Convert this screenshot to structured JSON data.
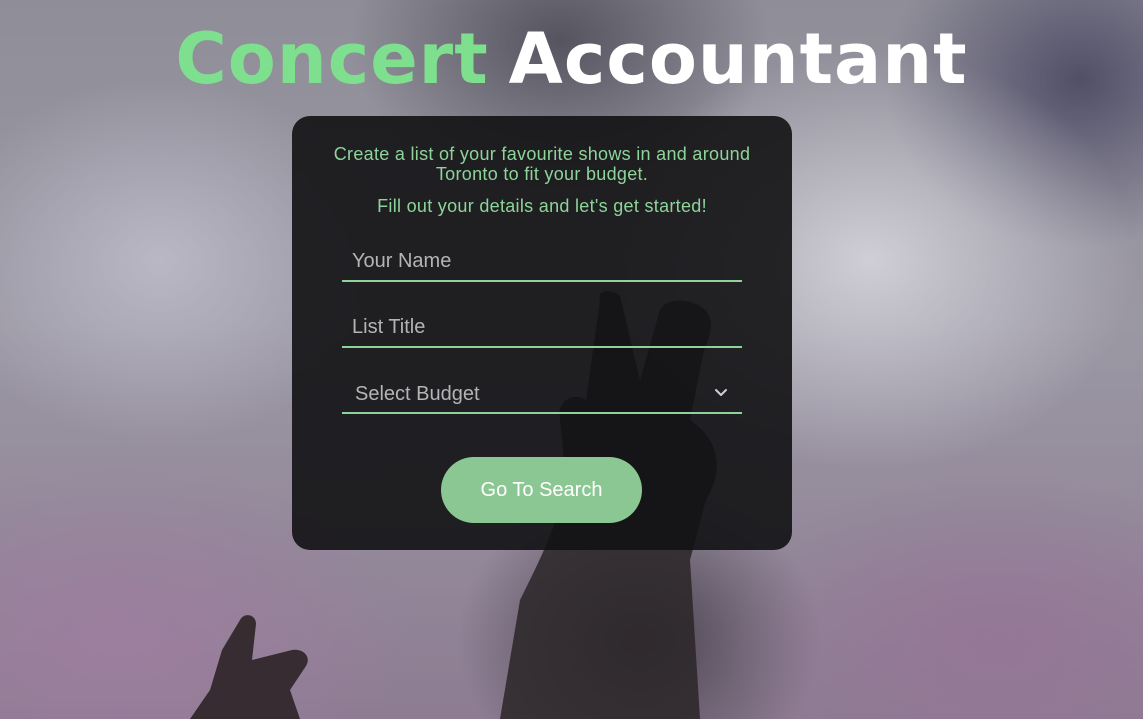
{
  "header": {
    "title_word_1": "Concert",
    "title_word_2": "Accountant"
  },
  "form": {
    "intro_text": "Create a list of your favourite shows in and around Toronto to fit your budget.",
    "prompt_text": "Fill out your details and let's get started!",
    "name_field": {
      "placeholder": "Your Name",
      "value": ""
    },
    "list_title_field": {
      "placeholder": "List Title",
      "value": ""
    },
    "budget_select": {
      "selected": "Select Budget",
      "icon": "chevron-down-icon"
    },
    "submit_label": "Go To Search"
  },
  "colors": {
    "accent_green": "#7ee08f",
    "text_green": "#8ed49a",
    "button_green": "#8bc793",
    "card_background": "#121214"
  }
}
